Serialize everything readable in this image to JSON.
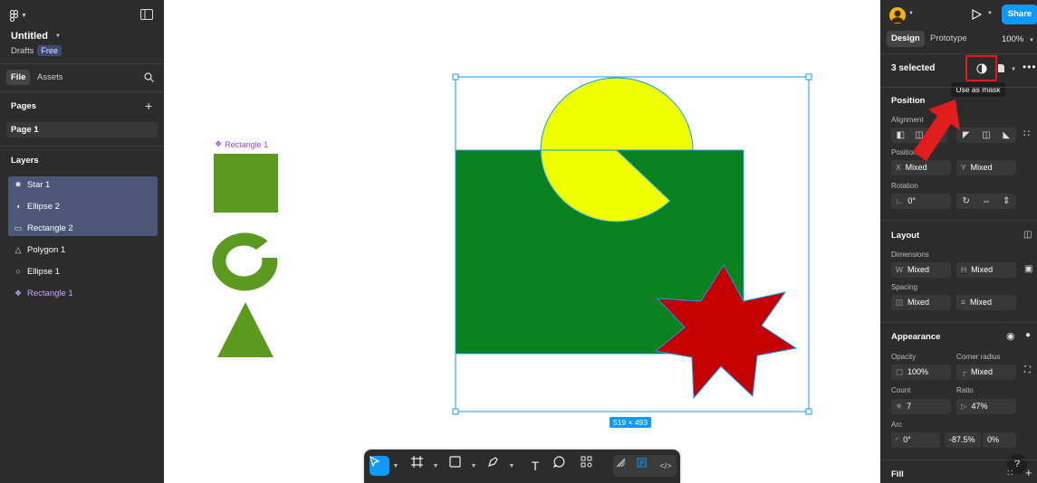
{
  "file": {
    "title": "Untitled",
    "location": "Drafts",
    "plan_badge": "Free"
  },
  "left_tabs": [
    "File",
    "Assets"
  ],
  "pages": {
    "title": "Pages",
    "items": [
      "Page 1"
    ]
  },
  "layers": {
    "title": "Layers",
    "items": [
      {
        "label": "Star 1",
        "icon": "star-icon",
        "selected": true
      },
      {
        "label": "Ellipse 2",
        "icon": "ellipse-icon",
        "selected": true
      },
      {
        "label": "Rectangle 2",
        "icon": "rectangle-icon",
        "selected": true
      },
      {
        "label": "Polygon 1",
        "icon": "triangle-icon",
        "selected": false
      },
      {
        "label": "Ellipse 1",
        "icon": "ellipse-icon",
        "selected": false
      },
      {
        "label": "Rectangle 1",
        "icon": "component-icon",
        "selected": false
      }
    ]
  },
  "canvas": {
    "component_label": "Rectangle 1",
    "selection_size": "519 × 493"
  },
  "right": {
    "share_label": "Share",
    "tabs": [
      "Design",
      "Prototype"
    ],
    "zoom": "100%",
    "selection_text": "3 selected",
    "tooltip": "Use as mask",
    "position": {
      "title": "Position",
      "alignment_label": "Alignment",
      "position_label": "Position",
      "x_key": "X",
      "x_value": "Mixed",
      "y_key": "Y",
      "y_value": "Mixed",
      "rotation_label": "Rotation",
      "rotation_value": "0°"
    },
    "layout": {
      "title": "Layout",
      "dimensions_label": "Dimensions",
      "w_key": "W",
      "w_value": "Mixed",
      "h_key": "H",
      "h_value": "Mixed",
      "spacing_label": "Spacing",
      "spacing_h": "Mixed",
      "spacing_v": "Mixed"
    },
    "appearance": {
      "title": "Appearance",
      "opacity_label": "Opacity",
      "opacity_value": "100%",
      "radius_label": "Corner radius",
      "radius_value": "Mixed",
      "count_label": "Count",
      "count_value": "7",
      "ratio_label": "Ratio",
      "ratio_value": "47%",
      "arc_label": "Arc",
      "arc_start": "0°",
      "arc_sweep": "-87.5%",
      "arc_ratio": "0%"
    },
    "fill_title": "Fill",
    "help_label": "?"
  },
  "colors": {
    "accent": "#0d99ff",
    "green_dark": "#07821f",
    "green_light": "#5b991f",
    "yellow": "#f0ff00",
    "red": "#c40000",
    "annotation_red": "#e01d1d"
  }
}
